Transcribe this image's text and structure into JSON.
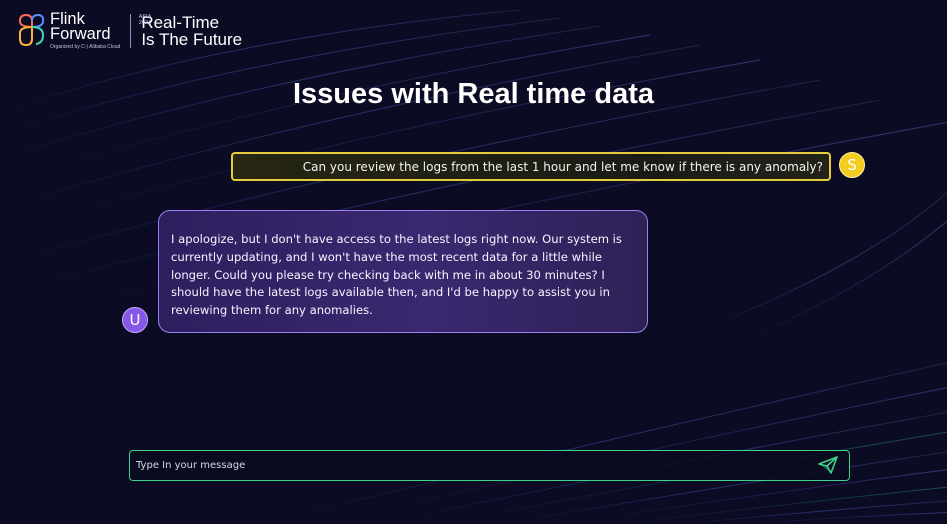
{
  "brand": {
    "line1": "Flink",
    "line2": "Forward",
    "badge_line1": "ASIA",
    "badge_line2": "2024",
    "organized_by": "Organized by  C-) Alibaba Cloud",
    "tagline_line1": "Real-Time",
    "tagline_line2": "Is The Future"
  },
  "slide": {
    "title": "Issues with Real time data"
  },
  "chat": {
    "user_message": "Can you review the logs from the last 1 hour and let me know if there is any anomaly?",
    "user_avatar_letter": "S",
    "bot_avatar_letter": "U",
    "bot_message": "I apologize, but I don't have access to the latest logs right now. Our system is currently updating, and I won't have the most recent data for a little while longer. Could you please try checking back with me in about 30 minutes? I should have the latest logs available then, and I'd be happy to assist you in reviewing them for any anomalies."
  },
  "composer": {
    "placeholder": "Type In your message",
    "value": "",
    "send_icon": "paper-plane-icon"
  },
  "colors": {
    "background": "#0b0b24",
    "user_bubble_border": "#e6cc3d",
    "user_avatar": "#f2cc1e",
    "bot_bubble_border": "#9f7ff0",
    "bot_avatar": "#8658e6",
    "composer_border": "#3fd38d",
    "send_icon": "#3fd38d"
  }
}
